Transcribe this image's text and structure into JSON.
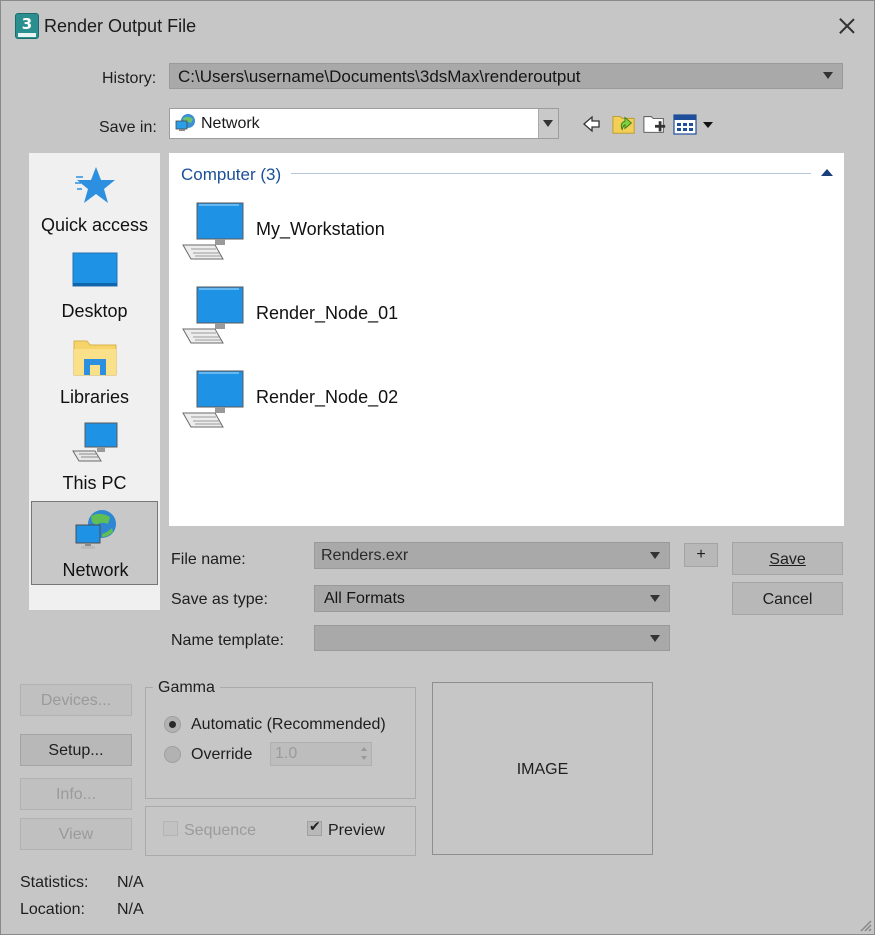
{
  "window": {
    "title": "Render Output File",
    "app_icon_text": "3"
  },
  "history": {
    "label": "History:",
    "value": "C:\\Users\\username\\Documents\\3dsMax\\renderoutput"
  },
  "save_in": {
    "label": "Save in:",
    "value": "Network"
  },
  "toolbar": {
    "icons": [
      "back-icon",
      "up-folder-icon",
      "new-folder-icon",
      "view-menu-icon"
    ]
  },
  "places": [
    {
      "label": "Quick access",
      "icon": "star-icon"
    },
    {
      "label": "Desktop",
      "icon": "desktop-icon"
    },
    {
      "label": "Libraries",
      "icon": "libraries-icon"
    },
    {
      "label": "This PC",
      "icon": "computer-icon"
    },
    {
      "label": "Network",
      "icon": "network-icon",
      "selected": true
    }
  ],
  "file_list": {
    "group_header": "Computer (3)",
    "items": [
      "My_Workstation",
      "Render_Node_01",
      "Render_Node_02"
    ]
  },
  "form": {
    "file_name_label": "File name:",
    "file_name_value": "Renders.exr",
    "add_button": "+",
    "save_as_type_label": "Save as type:",
    "save_as_type_value": "All Formats",
    "name_template_label": "Name template:",
    "name_template_value": ""
  },
  "buttons": {
    "save": "Save",
    "cancel": "Cancel",
    "devices": "Devices...",
    "setup": "Setup...",
    "info": "Info...",
    "view": "View"
  },
  "gamma": {
    "title": "Gamma",
    "automatic_label": "Automatic (Recommended)",
    "override_label": "Override",
    "override_value": "1.0",
    "automatic_selected": true
  },
  "options": {
    "sequence_label": "Sequence",
    "sequence_checked": false,
    "preview_label": "Preview",
    "preview_checked": true
  },
  "preview_image_label": "IMAGE",
  "stats": {
    "statistics_label": "Statistics:",
    "statistics_value": "N/A",
    "location_label": "Location:",
    "location_value": "N/A"
  },
  "colors": {
    "window_bg": "#c6c6c6",
    "list_bg": "#ffffff",
    "accent_blue": "#1a4f9a",
    "icon_blue": "#2b9ee8"
  }
}
